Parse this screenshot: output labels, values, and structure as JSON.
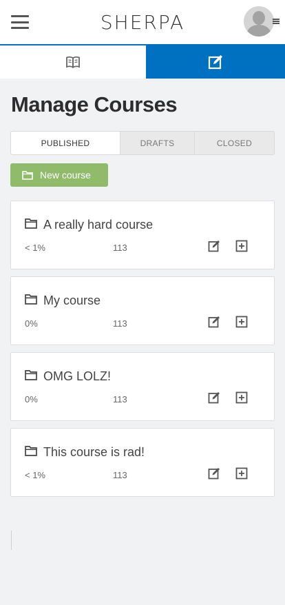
{
  "header": {
    "brand": "SHERPA",
    "menu_icon": "hamburger-icon",
    "avatar_icon": "user-avatar-icon"
  },
  "view_tabs": [
    {
      "icon": "book-icon",
      "active": false
    },
    {
      "icon": "edit-icon",
      "active": true
    }
  ],
  "page": {
    "title": "Manage Courses"
  },
  "filter_tabs": {
    "published": "PUBLISHED",
    "drafts": "DRAFTS",
    "closed": "CLOSED",
    "active": "published"
  },
  "actions": {
    "new_course": "New course"
  },
  "courses": [
    {
      "name": "A really hard course",
      "progress": "< 1%",
      "count": "113"
    },
    {
      "name": "My course",
      "progress": "0%",
      "count": "113"
    },
    {
      "name": "OMG LOLZ!",
      "progress": "0%",
      "count": "113"
    },
    {
      "name": "This course is rad!",
      "progress": "< 1%",
      "count": "113"
    }
  ],
  "colors": {
    "accent": "#0070c0",
    "new_course_button": "#8fbb6b",
    "background": "#f1f2f4"
  }
}
